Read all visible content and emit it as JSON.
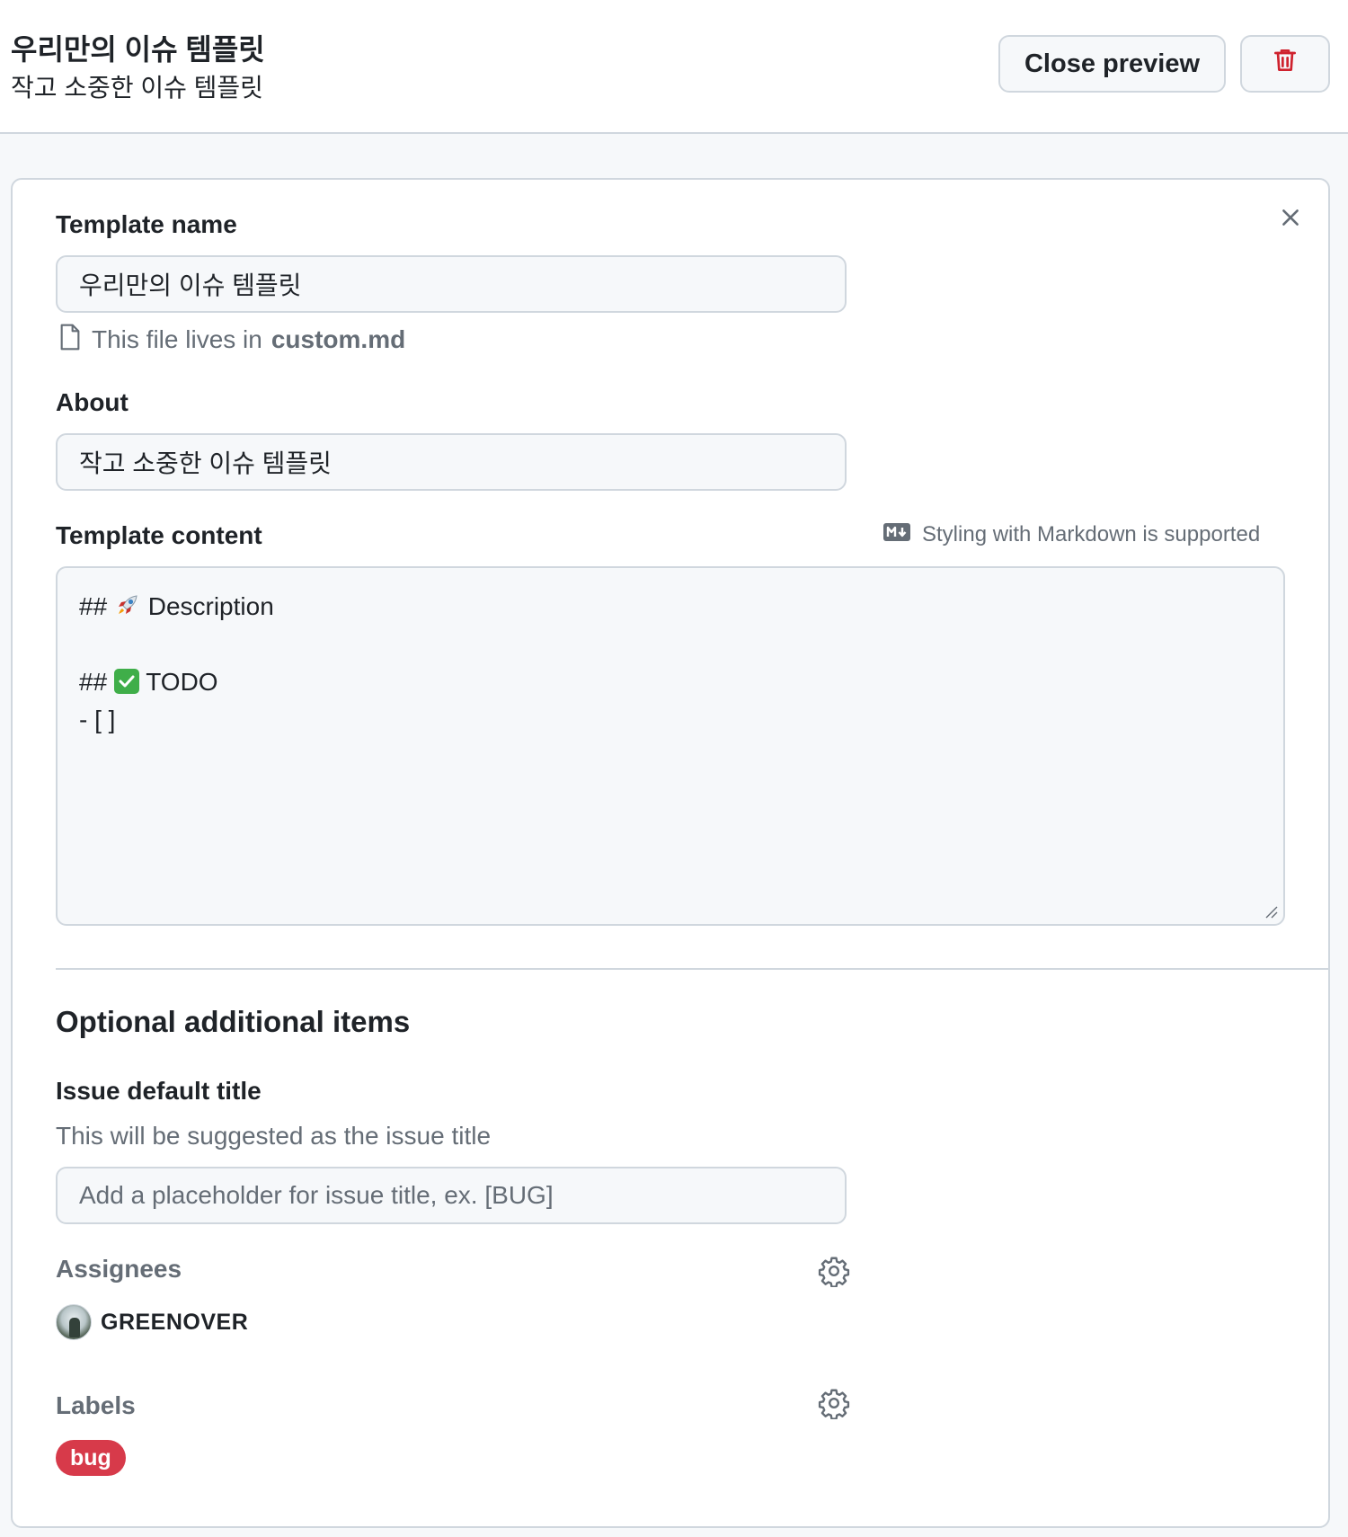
{
  "header": {
    "title": "우리만의 이슈 템플릿",
    "subtitle": "작고 소중한 이슈 템플릿",
    "close_preview_label": "Close preview"
  },
  "form": {
    "template_name_label": "Template name",
    "template_name_value": "우리만의 이슈 템플릿",
    "file_note_prefix": "This file lives in",
    "file_note_filename": "custom.md",
    "about_label": "About",
    "about_value": "작고 소중한 이슈 템플릿",
    "content_label": "Template content",
    "markdown_note": "Styling with Markdown is supported",
    "content_lines": {
      "line1_prefix": "## ",
      "line1_text": " Description",
      "line3_prefix": "## ",
      "line3_text": " TODO",
      "line4": "- [ ]"
    }
  },
  "optional": {
    "section_title": "Optional additional items",
    "issue_title_label": "Issue default title",
    "issue_title_helper": "This will be suggested as the issue title",
    "issue_title_placeholder": "Add a placeholder for issue title, ex. [BUG]",
    "assignees_label": "Assignees",
    "assignee_name": "GREENOVER",
    "labels_label": "Labels",
    "label_chip": "bug"
  },
  "colors": {
    "danger": "#cf222e",
    "label_bug": "#d73a4a",
    "muted_text": "#656d76",
    "border": "#d0d7de"
  },
  "icons": [
    "trash-icon",
    "close-icon",
    "file-icon",
    "markdown-icon",
    "rocket-emoji",
    "check-mark-emoji",
    "gear-icon"
  ]
}
